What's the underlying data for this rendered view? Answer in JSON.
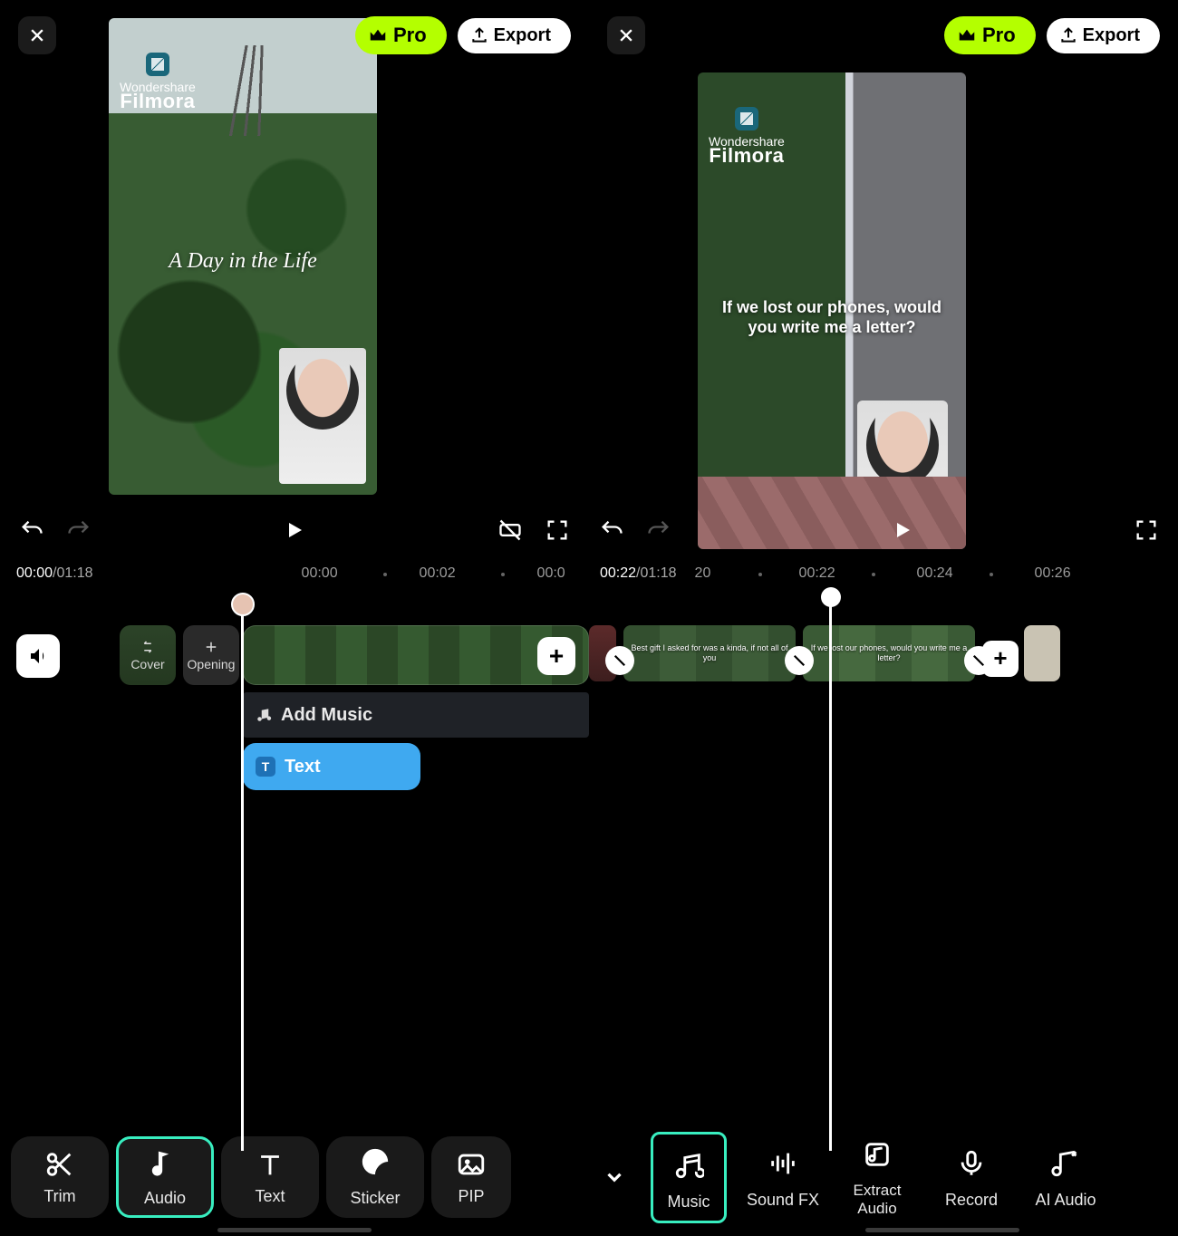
{
  "left": {
    "topbar": {
      "pro": "Pro",
      "export": "Export"
    },
    "brand": {
      "small": "Wondershare",
      "big": "Filmora"
    },
    "overlay_title": "A Day in the Life",
    "controls": {},
    "time": {
      "current": "00:00",
      "duration": "01:18",
      "ticks": [
        "00:00",
        "00:02",
        "00:0"
      ]
    },
    "tracks": {
      "cover": "Cover",
      "opening": "Opening",
      "add_music": "Add Music",
      "text_clip": "Text"
    },
    "toolbar": {
      "trim": "Trim",
      "audio": "Audio",
      "text": "Text",
      "sticker": "Sticker",
      "pip": "PIP"
    }
  },
  "right": {
    "topbar": {
      "pro": "Pro",
      "export": "Export"
    },
    "brand": {
      "small": "Wondershare",
      "big": "Filmora"
    },
    "overlay_caption": "If we lost our phones, would you write me a letter?",
    "time": {
      "current": "00:22",
      "duration": "01:18",
      "ticks": [
        "20",
        "00:22",
        "00:24",
        "00:26"
      ]
    },
    "clip_captions": [
      "Best gift I asked for was a kinda, if not all of you",
      "If we lost our phones, would you write me a letter?"
    ],
    "audio_toolbar": {
      "music": "Music",
      "sound_fx": "Sound FX",
      "extract": "Extract Audio",
      "record": "Record",
      "ai_audio": "AI Audio"
    }
  }
}
